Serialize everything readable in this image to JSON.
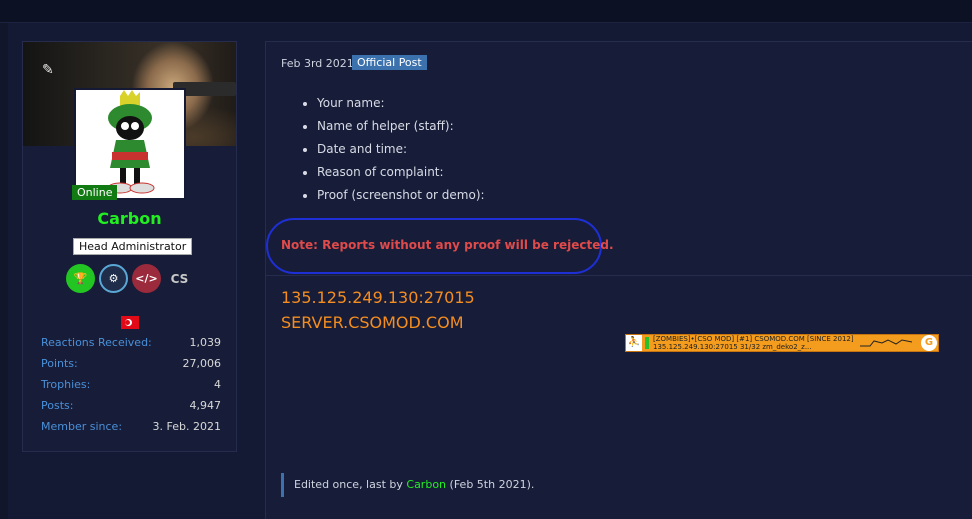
{
  "user": {
    "online_label": "Online",
    "name": "Carbon",
    "role": "Head Administrator",
    "stats": [
      {
        "label": "Reactions Received:",
        "value": "1,039"
      },
      {
        "label": "Points:",
        "value": "27,006"
      },
      {
        "label": "Trophies:",
        "value": "4"
      },
      {
        "label": "Posts:",
        "value": "4,947"
      },
      {
        "label": "Member since:",
        "value": "3. Feb. 2021"
      }
    ],
    "badge_icons": [
      "trophy-icon",
      "steam-icon",
      "code-icon",
      "cs-icon"
    ],
    "flag": "turkey-flag-icon"
  },
  "post": {
    "date": "Feb 3rd 2021",
    "official_label": "Official Post",
    "items": [
      "Your name:",
      "Name of helper (staff):",
      "Date and time:",
      "Reason of complaint:",
      "Proof (screenshot or demo):"
    ],
    "note": "Note: Reports without any proof will be rejected.",
    "server_ip": "135.125.249.130:27015",
    "server_domain": "SERVER.CSOMOD.COM",
    "banner_line1": "[ZOMBIES]•[CSO MOD] [#1] CSOMOD.COM [SINCE 2012]",
    "banner_line2": "135.125.249.130:27015     31/32     zm_deko2_z...",
    "edited_prefix": "Edited once, last by ",
    "edited_user": "Carbon",
    "edited_suffix": " (Feb 5th 2021)."
  },
  "colors": {
    "accent": "#3b72ad",
    "online": "#127a12",
    "username": "#22ee22",
    "note": "#e04a4a",
    "server": "#f58d1f"
  }
}
